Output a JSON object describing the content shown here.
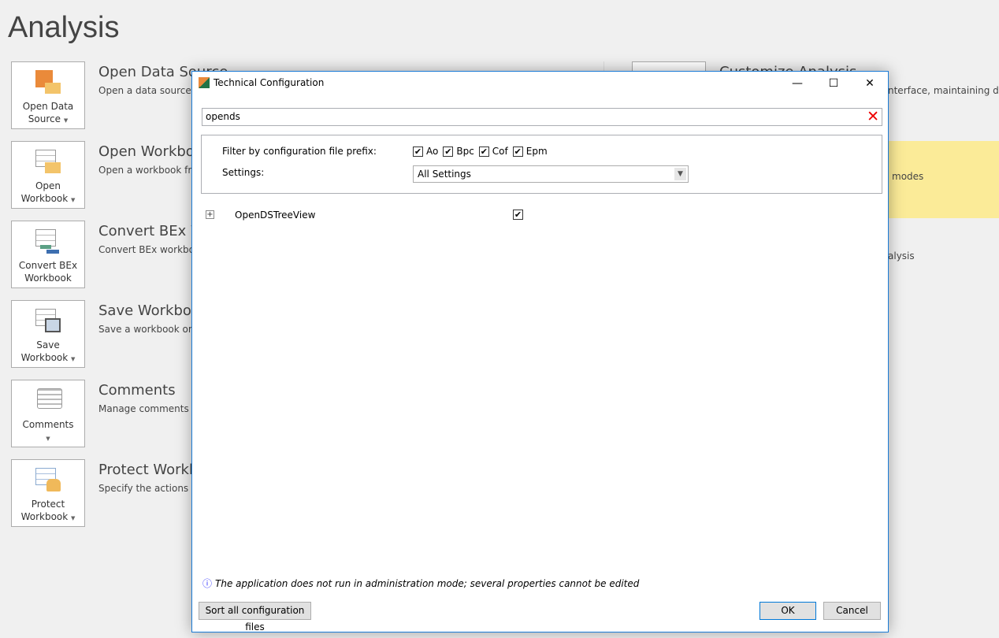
{
  "page": {
    "title": "Analysis"
  },
  "items": [
    {
      "tile": "Open Data Source",
      "tile1": "Open Data",
      "tile2": "Source",
      "heading": "Open Data Source",
      "desc": "Open a data source in"
    },
    {
      "tile1": "Open",
      "tile2": "Workbook",
      "heading": "Open Workbook",
      "desc": "Open a workbook from"
    },
    {
      "tile1": "Convert BEx",
      "tile2": "Workbook",
      "heading": "Convert BEx W",
      "desc": "Convert BEx workbook"
    },
    {
      "tile1": "Save",
      "tile2": "Workbook",
      "heading": "Save Workbook",
      "desc": "Save a workbook on a"
    },
    {
      "tile1": "Comments",
      "tile2": "",
      "heading": "Comments",
      "desc": "Manage comments fo"
    },
    {
      "tile1": "Protect",
      "tile2": "Workbook",
      "heading": "Protect Workbook",
      "desc": "Specify the actions tha"
    }
  ],
  "right": {
    "heading": "Customize Analysis",
    "desc1": "nterface, maintaining differ",
    "desc2": "modes",
    "desc3": "alysis",
    "highlight_color": "#fbeb98"
  },
  "dialog": {
    "title": "Technical Configuration",
    "search_value": "opends",
    "filter_label": "Filter by configuration file prefix:",
    "prefixes": [
      {
        "label": "Ao",
        "checked": true
      },
      {
        "label": "Bpc",
        "checked": true
      },
      {
        "label": "Cof",
        "checked": true
      },
      {
        "label": "Epm",
        "checked": true
      }
    ],
    "settings_label": "Settings:",
    "settings_value": "All Settings",
    "tree": [
      {
        "label": "OpenDSTreeView",
        "checked": true
      }
    ],
    "info": "The application does not run in administration mode; several properties cannot be edited",
    "sort_button": "Sort all configuration files",
    "ok": "OK",
    "cancel": "Cancel"
  }
}
